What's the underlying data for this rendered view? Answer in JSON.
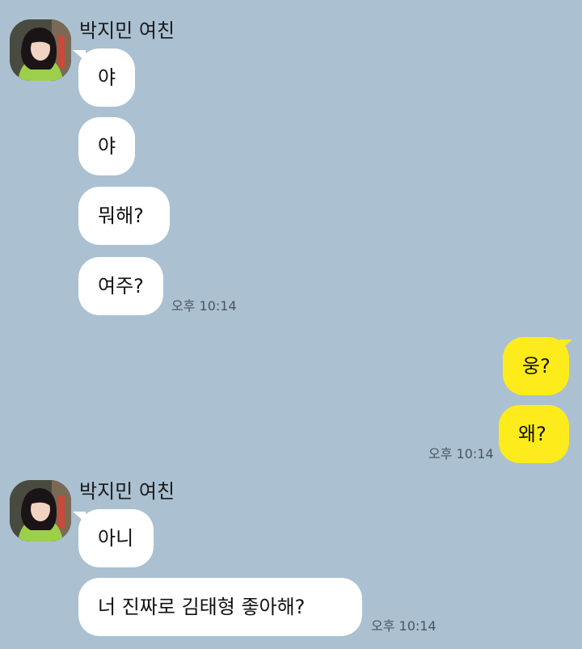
{
  "colors": {
    "background": "#abc1d1",
    "incoming_bubble": "#ffffff",
    "outgoing_bubble": "#fdeb1c"
  },
  "groups": [
    {
      "sender": "박지민 여친",
      "direction": "incoming",
      "avatar_icon": "profile-photo-icon",
      "messages": [
        "야",
        "야",
        "뭐해?",
        "여주?"
      ],
      "time": "오후 10:14"
    },
    {
      "direction": "outgoing",
      "messages": [
        "웅?",
        "왜?"
      ],
      "time": "오후 10:14"
    },
    {
      "sender": "박지민 여친",
      "direction": "incoming",
      "avatar_icon": "profile-photo-icon",
      "messages": [
        "아니",
        "너 진짜로 김태형 좋아해?"
      ],
      "time": "오후 10:14"
    }
  ]
}
